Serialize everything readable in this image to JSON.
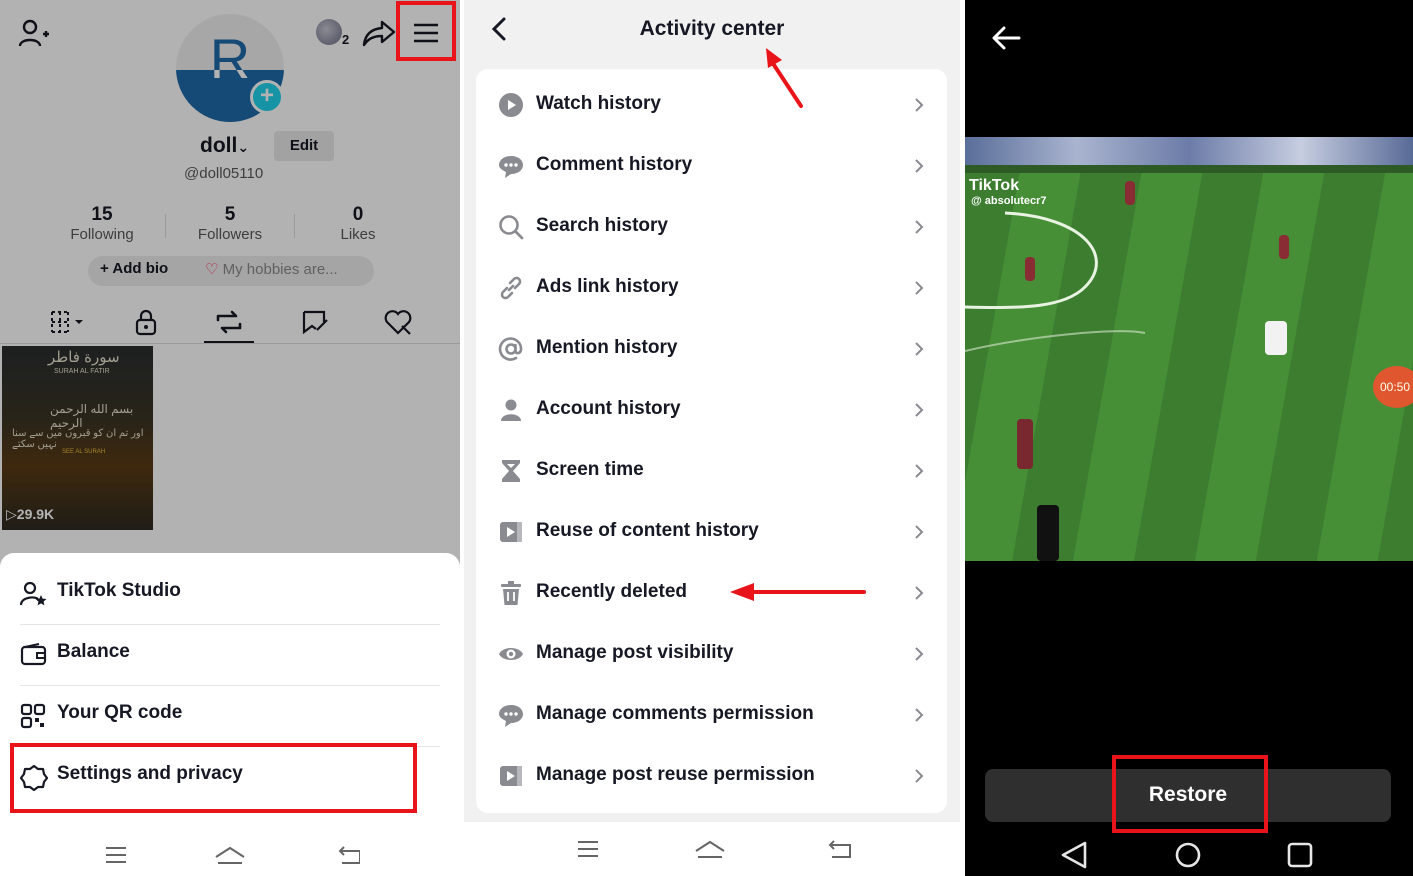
{
  "profile": {
    "avatar_letter": "R",
    "notif_count": "2",
    "username": "doll",
    "edit_label": "Edit",
    "handle": "@doll05110",
    "stats": [
      {
        "number": "15",
        "label": "Following"
      },
      {
        "number": "5",
        "label": "Followers"
      },
      {
        "number": "0",
        "label": "Likes"
      }
    ],
    "add_bio": "+ Add bio",
    "hobbies": "My hobbies are...",
    "video": {
      "line1": "سورة فاطر",
      "line2": "SURAH AL FATIR",
      "line3": "بسم الله الرحمن الرحيم",
      "line4": "اور تم ان کو قبروں میں سے سنا نہیں سکتے",
      "line5": "SEE AL SURAH",
      "views": "29.9K"
    },
    "menu": [
      {
        "label": "TikTok Studio",
        "icon": "person-star-icon"
      },
      {
        "label": "Balance",
        "icon": "wallet-icon"
      },
      {
        "label": "Your QR code",
        "icon": "qr-code-icon"
      },
      {
        "label": "Settings and privacy",
        "icon": "gear-icon"
      }
    ]
  },
  "activity": {
    "title": "Activity center",
    "items": [
      {
        "label": "Watch history",
        "icon": "play-circle-icon"
      },
      {
        "label": "Comment history",
        "icon": "comment-icon"
      },
      {
        "label": "Search history",
        "icon": "search-icon"
      },
      {
        "label": "Ads link history",
        "icon": "link-icon"
      },
      {
        "label": "Mention history",
        "icon": "at-icon"
      },
      {
        "label": "Account history",
        "icon": "person-icon"
      },
      {
        "label": "Screen time",
        "icon": "hourglass-icon"
      },
      {
        "label": "Reuse of content history",
        "icon": "reuse-icon"
      },
      {
        "label": "Recently deleted",
        "icon": "trash-icon"
      },
      {
        "label": "Manage post visibility",
        "icon": "eye-icon"
      },
      {
        "label": "Manage comments permission",
        "icon": "comment-icon"
      },
      {
        "label": "Manage post reuse permission",
        "icon": "reuse-icon"
      }
    ]
  },
  "restore_view": {
    "watermark_brand": "TikTok",
    "watermark_user": "@ absolutecr7",
    "timer": "00:50",
    "restore_label": "Restore"
  },
  "colors": {
    "annotation_red": "#e8141a",
    "tiktok_cyan": "#20d5ec",
    "avatar_blue": "#1e6aa8"
  }
}
